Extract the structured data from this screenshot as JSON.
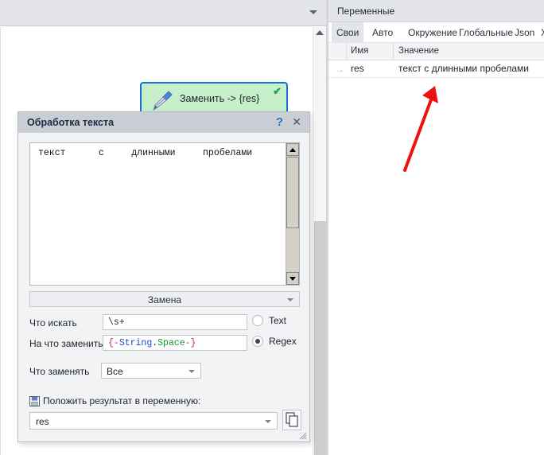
{
  "toolbar": {
    "chevron_icon": "chevron-down-icon"
  },
  "canvas": {
    "node": {
      "label": "Заменить -> {res}",
      "icon": "pen-nib-icon",
      "status_icon": "check-icon",
      "bg_color": "#c5f0c9",
      "border_color": "#1a6fd4",
      "check_color": "#17a84a"
    }
  },
  "dialog": {
    "title": "Обработка текста",
    "help_label": "?",
    "close_label": "✕",
    "text_area": {
      "value": "текст      с     длинными     пробелами"
    },
    "mode_combo": {
      "value": "Замена"
    },
    "fields": {
      "search_label": "Что искать",
      "search_value": "\\s+",
      "replace_label": "На что заменить",
      "replace_value": {
        "open_brace": "{-",
        "namespace": "String",
        "dot": ".",
        "property": "Space",
        "close_brace": "-}"
      },
      "scope_label": "Что заменять",
      "scope_value": "Все"
    },
    "radios": [
      {
        "label": "Text",
        "checked": false
      },
      {
        "label": "Regex",
        "checked": true
      }
    ],
    "save_to_variable": {
      "icon": "save-floppy-icon",
      "label": "Положить результат в переменную:",
      "variable_value": "res",
      "copy_icon": "copy-icon"
    },
    "resize_grip_icon": "resize-grip-icon"
  },
  "variables_panel": {
    "title": "Переменные",
    "tabs": [
      {
        "label": "Свои",
        "active": true
      },
      {
        "label": "Авто",
        "active": false
      },
      {
        "label": "Окружение",
        "active": false
      },
      {
        "label": "Глобальные",
        "active": false
      },
      {
        "label": "Json",
        "active": false
      },
      {
        "label": "Xm",
        "active": false
      }
    ],
    "columns": [
      "Имя",
      "Значение"
    ],
    "rows": [
      {
        "arrow": "→",
        "name": "res",
        "value": "текст с длинными пробелами"
      }
    ]
  },
  "annotation": {
    "arrow_color": "#ee1111",
    "arrow_icon": "red-arrow-annotation"
  }
}
